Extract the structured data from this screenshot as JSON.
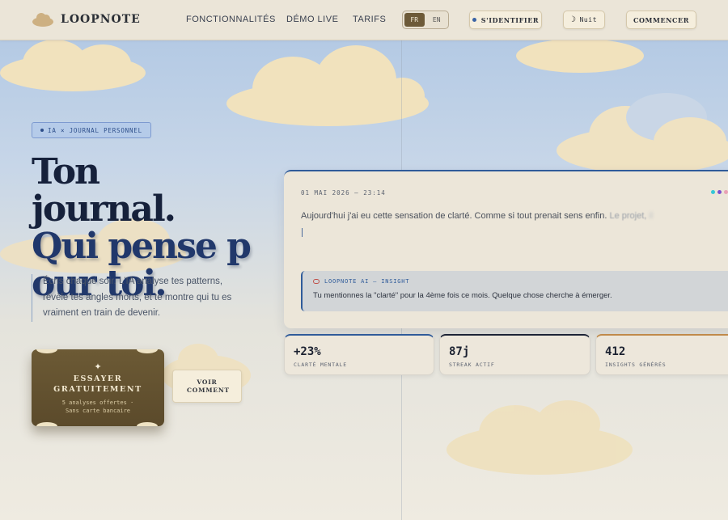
{
  "nav": {
    "brand": "LOOPNOTE",
    "links": [
      "FONCTIONNALITÉS",
      "DÉMO LIVE",
      "TARIFS"
    ],
    "lang": {
      "fr": "FR",
      "en": "EN",
      "active": "FR"
    },
    "signin": "S'IDENTIFIER",
    "theme": "Nuit",
    "start": "COMMENCER"
  },
  "hero": {
    "tag": "IA × JOURNAL PERSONNEL",
    "title_line1": "Ton journal.",
    "title_line2": "Qui pense pour toi.",
    "description": "Écris chaque soir. L'IA analyse tes patterns, révèle tes angles morts, et te montre qui tu es vraiment en train de devenir.",
    "cta_main": "ESSAYER GRATUITEMENT",
    "cta_sub_1": "5 analyses offertes ·",
    "cta_sub_2": "Sans carte bancaire",
    "secondary": "VOIR COMMENT"
  },
  "journal": {
    "date": "01 MAI 2026 — 23:14",
    "entry_text": "Aujourd'hui j'ai eu cette sensation de clarté. Comme si tout prenait sens enfin.",
    "entry_fade": "Le projet,",
    "entry_fade2": "il",
    "dot_colors": [
      "#35c7d6",
      "#7a4fd0",
      "#e9a1b6"
    ],
    "insight_label": "LOOPNOTE AI — INSIGHT",
    "insight_text": "Tu mentionnes la \"clarté\" pour la 4ème fois ce mois. Quelque chose cherche à émerger."
  },
  "stats": [
    {
      "value": "+23%",
      "label": "CLARTÉ MENTALE",
      "accent": "#2f5b9a"
    },
    {
      "value": "87j",
      "label": "STREAK ACTIF",
      "accent": "#1d2436"
    },
    {
      "value": "412",
      "label": "INSIGHTS GÉNÉRÉS",
      "accent": "#c08a4a"
    }
  ],
  "colors": {
    "accent_blue": "#2f5b9a",
    "cta_brown": "#6c5a35",
    "navy_title": "#16213b"
  }
}
